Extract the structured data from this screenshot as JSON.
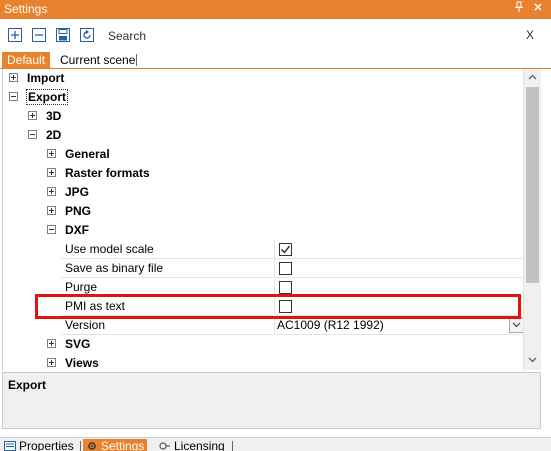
{
  "window": {
    "title": "Settings",
    "pin_icon": "pin-icon",
    "close_icon": "close-icon"
  },
  "toolbar": {
    "search_label": "Search",
    "close_label": "X",
    "icons": [
      "expand-all-icon",
      "collapse-all-icon",
      "save-icon",
      "reset-icon"
    ]
  },
  "tabs": [
    {
      "label": "Default",
      "active": true
    },
    {
      "label": "Current scene",
      "active": false
    }
  ],
  "tree": {
    "import": "Import",
    "export": "Export",
    "n3d": "3D",
    "n2d": "2D",
    "general": "General",
    "raster": "Raster formats",
    "jpg": "JPG",
    "png": "PNG",
    "dxf": "DXF",
    "svg": "SVG",
    "views": "Views"
  },
  "dxf_properties": [
    {
      "name": "Use model scale",
      "type": "checkbox",
      "checked": true
    },
    {
      "name": "Save as binary file",
      "type": "checkbox",
      "checked": false
    },
    {
      "name": "Purge",
      "type": "checkbox",
      "checked": false
    },
    {
      "name": "PMI as text",
      "type": "checkbox",
      "checked": false
    },
    {
      "name": "Version",
      "type": "select",
      "value": "AC1009 (R12 1992)"
    }
  ],
  "description": {
    "title": "Export"
  },
  "bottom_tabs": [
    {
      "label": "Properties",
      "icon": "properties-icon",
      "active": false
    },
    {
      "label": "Settings",
      "icon": "settings-gear-icon",
      "active": true
    },
    {
      "label": "Licensing",
      "icon": "licensing-icon",
      "active": false
    }
  ],
  "colors": {
    "accent": "#e8822e",
    "highlight": "#e3130e"
  }
}
